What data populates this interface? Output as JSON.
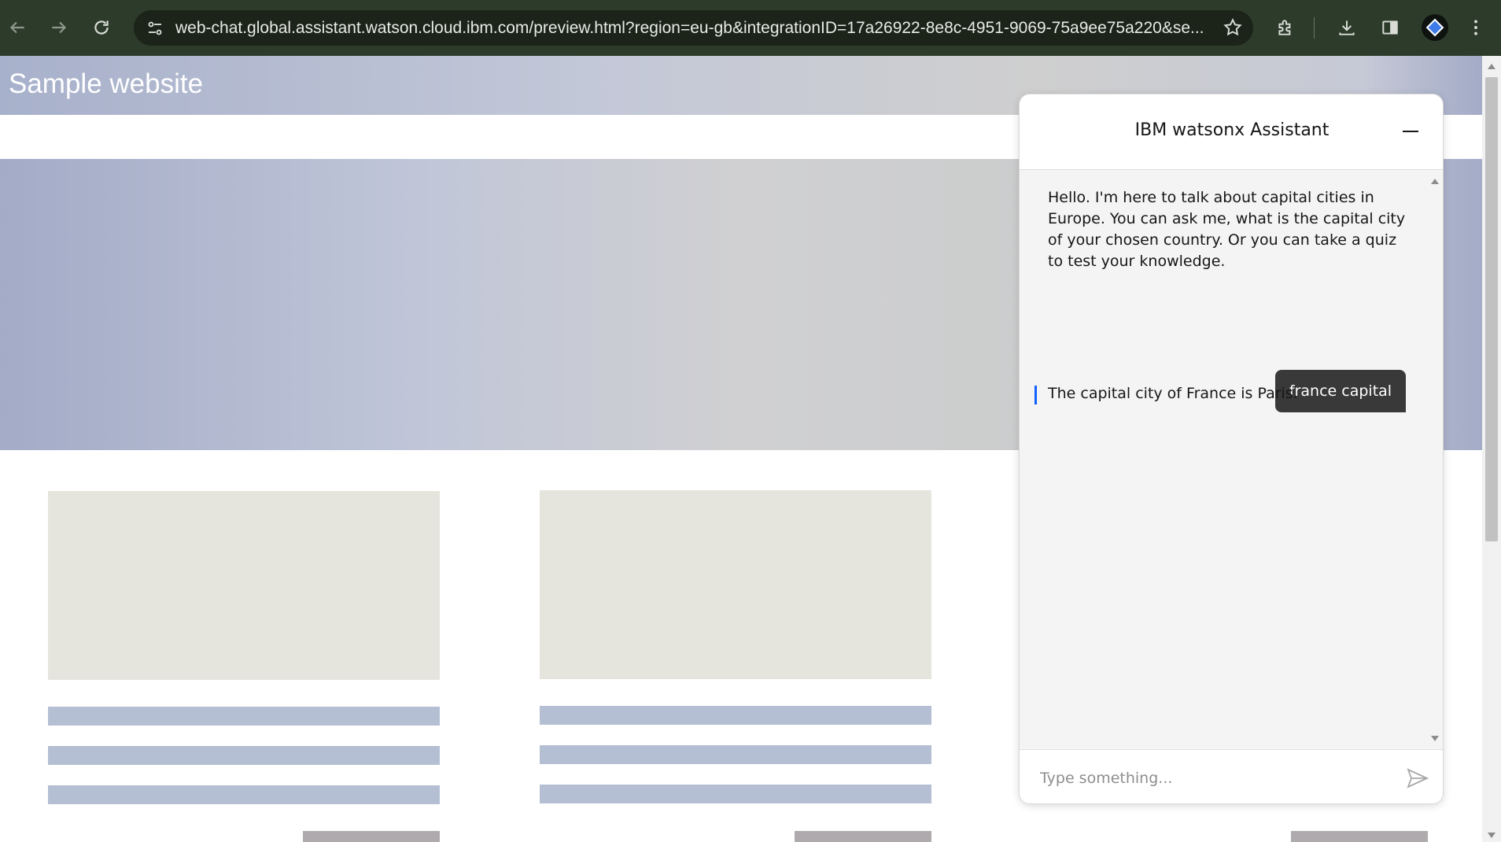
{
  "browser": {
    "url": "web-chat.global.assistant.watson.cloud.ibm.com/preview.html?region=eu-gb&integrationID=17a26922-8e8c-4951-9069-75a9ee75a220&se..."
  },
  "site": {
    "title": "Sample website"
  },
  "chat": {
    "title": "IBM watsonx Assistant",
    "messages": [
      {
        "from": "bot",
        "text": "Hello. I'm here to talk about capital cities in Europe. You can ask me, what is the capital city of your chosen country. Or you can take a quiz to test your knowledge."
      },
      {
        "from": "user",
        "text": "france capital"
      },
      {
        "from": "bot",
        "text": "The capital city of France is Paris."
      }
    ],
    "input_placeholder": "Type something..."
  },
  "colors": {
    "browser_toolbar": "#2c3b2a",
    "user_bubble": "#393939",
    "bot_marker": "#0f62fe",
    "chat_background": "#f4f4f4"
  }
}
